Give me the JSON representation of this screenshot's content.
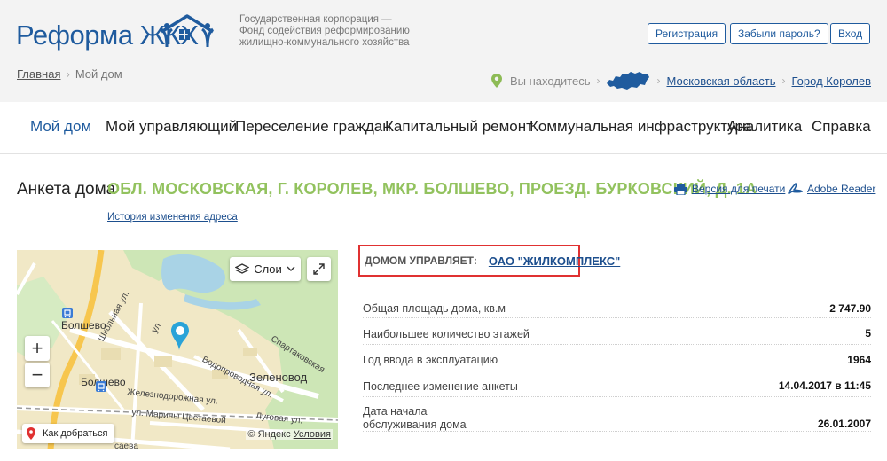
{
  "header": {
    "logo_text": "Реформа ЖКХ",
    "org_lines": [
      "Государственная корпорация —",
      "Фонд содействия реформированию",
      "жилищно-коммунального хозяйства"
    ],
    "buttons": {
      "register": "Регистрация",
      "forgot": "Забыли пароль?",
      "login": "Вход"
    },
    "breadcrumb": {
      "home": "Главная",
      "current": "Мой дом",
      "sep": "›"
    },
    "location": {
      "label": "Вы находитесь",
      "region": "Московская область",
      "city": "Город Королев",
      "sep": "›"
    }
  },
  "nav": [
    "Мой дом",
    "Мой управляющий",
    "Переселение граждан",
    "Капитальный ремонт",
    "Коммунальная инфраструктура",
    "Аналитика",
    "Справка"
  ],
  "page": {
    "title_label": "Анкета дома",
    "address": "ОБЛ. МОСКОВСКАЯ, Г. КОРОЛЕВ, МКР. БОЛШЕВО, ПРОЕЗД. БУРКОВСКИЙ, Д. 1А",
    "address_history": "История изменения адреса",
    "print_link": "Версия для печати",
    "reader_link": "Adobe Reader"
  },
  "map": {
    "layers": "Слои",
    "route": "Как добраться",
    "copyright": "© Яндекс",
    "terms": "Условия",
    "zoom_in": "+",
    "zoom_out": "−",
    "labels": {
      "bolshevo_top": "Болшево",
      "bolshevo_bottom": "Болшево",
      "zelenovod": "Зеленовод",
      "shkolnaya": "Школьная ул.",
      "vodoprovodnaya": "Водопроводная ул.",
      "spartakovskaya": "Спартаковская",
      "zheleznodorozhnaya": "Железнодорожная ул.",
      "marina": "ул. Марины Цветаевой",
      "lugovaya": "Луговая ул.",
      "saeva": "саева",
      "ul_frag": "ул."
    }
  },
  "manager": {
    "label": "ДОМОМ УПРАВЛЯЕТ:",
    "name": "ОАО \"ЖИЛКОМПЛЕКС\""
  },
  "facts": [
    {
      "key": "Общая площадь дома, кв.м",
      "value": "2 747.90"
    },
    {
      "key": "Наибольшее количество этажей",
      "value": "5"
    },
    {
      "key": "Год ввода в эксплуатацию",
      "value": "1964"
    },
    {
      "key": "Последнее изменение анкеты",
      "value": "14.04.2017 в 11:45"
    },
    {
      "key_line1": "Дата начала",
      "key_line2": "обслуживания дома",
      "value": "26.01.2007"
    }
  ],
  "colors": {
    "brand_blue": "#1f5b9e",
    "address_green": "#92c25e",
    "highlight_red": "#e03131",
    "header_bg": "#f3f3f3"
  }
}
